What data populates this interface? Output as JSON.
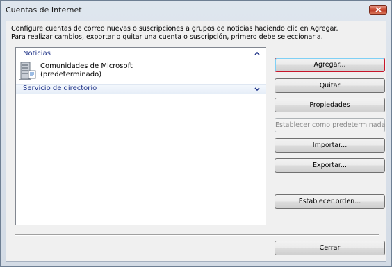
{
  "window": {
    "title": "Cuentas de Internet"
  },
  "description": {
    "line1": "Configure cuentas de correo nuevas o suscripciones a grupos de noticias haciendo clic en Agregar.",
    "line2": "Para realizar cambios, exportar o quitar una cuenta o suscripción, primero debe seleccionarla."
  },
  "accounts": {
    "groups": [
      {
        "label": "Noticias",
        "state": "expanded",
        "items": [
          {
            "line1": "Comunidades de Microsoft",
            "line2": "(predeterminado)",
            "icon": "newsgroup-server-icon"
          }
        ]
      },
      {
        "label": "Servicio de directorio",
        "state": "collapsed",
        "items": []
      }
    ]
  },
  "buttons": {
    "add": "Agregar...",
    "remove": "Quitar",
    "properties": "Propiedades",
    "set_default": "Establecer como predeterminada",
    "import": "Importar...",
    "export": "Exportar...",
    "set_order": "Establecer orden...",
    "close": "Cerrar"
  },
  "colors": {
    "group_header": "#1e3287",
    "default_button_border": "#c7162b",
    "close_button": "#c8472e"
  }
}
